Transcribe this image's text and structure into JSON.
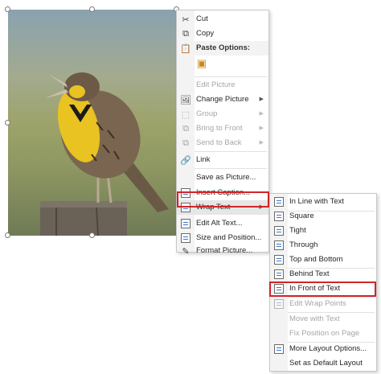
{
  "context_menu": {
    "items": [
      {
        "label": "Cut",
        "icon": "scissors-icon",
        "enabled": true
      },
      {
        "label": "Copy",
        "icon": "copy-icon",
        "enabled": true
      },
      {
        "label": "Paste Options:",
        "icon": "paste-icon",
        "enabled": true
      },
      {
        "label": "Edit Picture",
        "icon": "edit-picture-icon",
        "enabled": false
      },
      {
        "label": "Change Picture",
        "icon": "change-picture-icon",
        "enabled": true,
        "submenu": true
      },
      {
        "label": "Group",
        "icon": "group-icon",
        "enabled": false,
        "submenu": true
      },
      {
        "label": "Bring to Front",
        "icon": "bring-to-front-icon",
        "enabled": false,
        "submenu": true
      },
      {
        "label": "Send to Back",
        "icon": "send-to-back-icon",
        "enabled": false,
        "submenu": true
      },
      {
        "label": "Link",
        "icon": "link-icon",
        "enabled": true
      },
      {
        "label": "Save as Picture...",
        "icon": "",
        "enabled": true
      },
      {
        "label": "Insert Caption...",
        "icon": "insert-caption-icon",
        "enabled": true
      },
      {
        "label": "Wrap Text",
        "icon": "wrap-text-icon",
        "enabled": true,
        "submenu": true,
        "highlighted": true
      },
      {
        "label": "Edit Alt Text...",
        "icon": "alt-text-icon",
        "enabled": true
      },
      {
        "label": "Size and Position...",
        "icon": "size-position-icon",
        "enabled": true
      },
      {
        "label": "Format Picture...",
        "icon": "format-picture-icon",
        "enabled": true
      }
    ]
  },
  "wrap_submenu": {
    "items": [
      {
        "label": "In Line with Text",
        "icon": "inline-text-icon",
        "enabled": true
      },
      {
        "label": "Square",
        "icon": "square-wrap-icon",
        "enabled": true
      },
      {
        "label": "Tight",
        "icon": "tight-wrap-icon",
        "enabled": true
      },
      {
        "label": "Through",
        "icon": "through-wrap-icon",
        "enabled": true
      },
      {
        "label": "Top and Bottom",
        "icon": "top-bottom-wrap-icon",
        "enabled": true
      },
      {
        "label": "Behind Text",
        "icon": "behind-text-icon",
        "enabled": true
      },
      {
        "label": "In Front of Text",
        "icon": "in-front-text-icon",
        "enabled": true,
        "highlighted": true
      },
      {
        "label": "Edit Wrap Points",
        "icon": "edit-wrap-points-icon",
        "enabled": false
      },
      {
        "label": "Move with Text",
        "icon": "",
        "enabled": false
      },
      {
        "label": "Fix Position on Page",
        "icon": "",
        "enabled": false
      },
      {
        "label": "More Layout Options...",
        "icon": "layout-options-icon",
        "enabled": true
      },
      {
        "label": "Set as Default Layout",
        "icon": "",
        "enabled": true
      }
    ]
  },
  "colors": {
    "highlight_border": "#d0252a",
    "menu_border": "#c8c8c8"
  }
}
